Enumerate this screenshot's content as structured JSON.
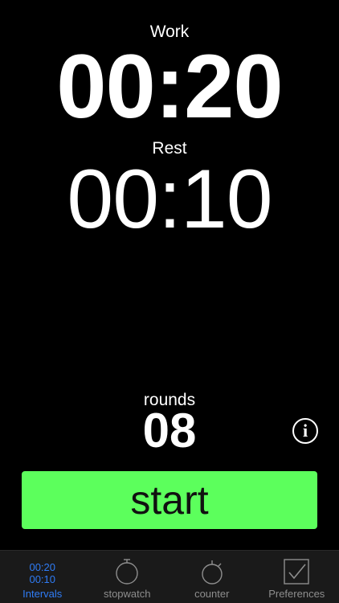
{
  "timer": {
    "work_label": "Work",
    "work_time": "00:20",
    "rest_label": "Rest",
    "rest_time": "00:10",
    "rounds_label": "rounds",
    "rounds_value": "08"
  },
  "controls": {
    "info_glyph": "i",
    "start_label": "start",
    "start_color": "#5cff5c"
  },
  "tab_bar": {
    "active_color": "#2f7cf6",
    "inactive_color": "#8e8e8e",
    "tabs": [
      {
        "label": "Intervals",
        "icon": "interval-times-icon",
        "icon_line1": "00:20",
        "icon_line2": "00:10",
        "active": true
      },
      {
        "label": "stopwatch",
        "icon": "stopwatch-icon",
        "active": false
      },
      {
        "label": "counter",
        "icon": "counter-icon",
        "active": false
      },
      {
        "label": "Preferences",
        "icon": "checkbox-icon",
        "active": false
      }
    ]
  }
}
